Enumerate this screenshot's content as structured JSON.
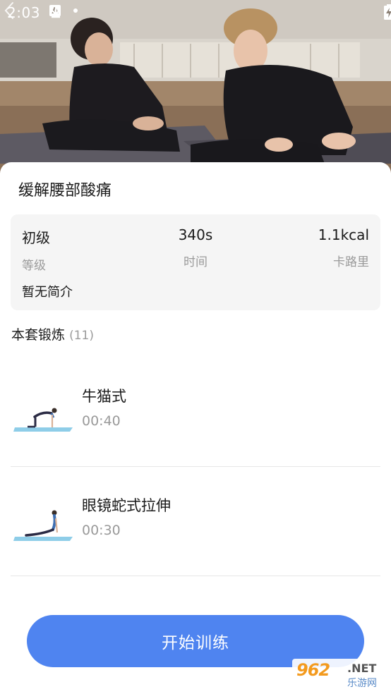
{
  "status_bar": {
    "time": "2:03",
    "left_icons": [
      "download-icon",
      "download-icon",
      "download-icon",
      "a-notification-icon",
      "dot-icon"
    ],
    "right_icons": [
      "wifi-icon",
      "signal-icon",
      "battery-charging-icon"
    ]
  },
  "hero": {
    "image": "two women stretching on yoga mats in a dance studio"
  },
  "workout": {
    "title": "缓解腰部酸痛",
    "stats": [
      {
        "value": "初级",
        "label": "等级"
      },
      {
        "value": "340s",
        "label": "时间"
      },
      {
        "value": "1.1kcal",
        "label": "卡路里"
      }
    ],
    "intro": "暂无简介"
  },
  "exercises_section": {
    "title": "本套锻炼",
    "count": "(11)"
  },
  "exercises": [
    {
      "name": "牛猫式",
      "duration": "00:40"
    },
    {
      "name": "眼镜蛇式拉伸",
      "duration": "00:30"
    }
  ],
  "start_button": {
    "label": "开始训练"
  },
  "watermark": {
    "main": "962",
    "net": ".NET",
    "sub": "乐游网"
  },
  "colors": {
    "accent": "#4f84f0",
    "card_bg": "#f5f5f5",
    "muted_text": "#9a9a9a",
    "mat": "#8ecde8"
  }
}
